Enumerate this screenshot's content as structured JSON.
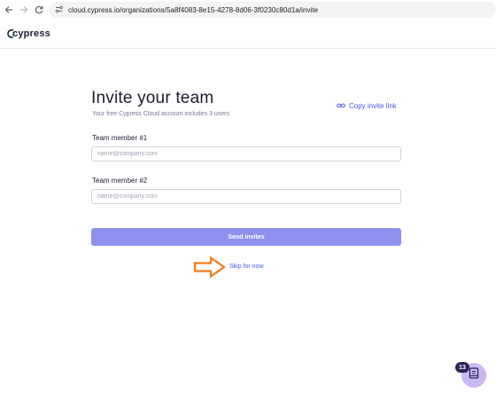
{
  "browser": {
    "url": "cloud.cypress.io/organizations/5a8f4083-8e15-4278-8d06-3f0230c80d1a/invite"
  },
  "header": {
    "logo_text": "cypress"
  },
  "invite": {
    "title": "Invite your team",
    "subtitle": "Your free Cypress Cloud account includes 3 users",
    "copy_link_label": "Copy invite link",
    "members": [
      {
        "label": "Team member #1",
        "placeholder": "name@company.com",
        "value": ""
      },
      {
        "label": "Team member #2",
        "placeholder": "name@company.com",
        "value": ""
      }
    ],
    "send_label": "Send invites",
    "skip_label": "Skip for now"
  },
  "widget": {
    "badge_count": "13"
  },
  "colors": {
    "accent": "#4956e3",
    "button_bg": "#8c91ee",
    "annotation": "#f07c1e",
    "widget_bg": "#c9b8f2"
  },
  "icons": [
    "back-arrow-icon",
    "forward-arrow-icon",
    "reload-icon",
    "site-info-icon",
    "link-icon",
    "annotation-arrow-icon",
    "book-icon"
  ]
}
